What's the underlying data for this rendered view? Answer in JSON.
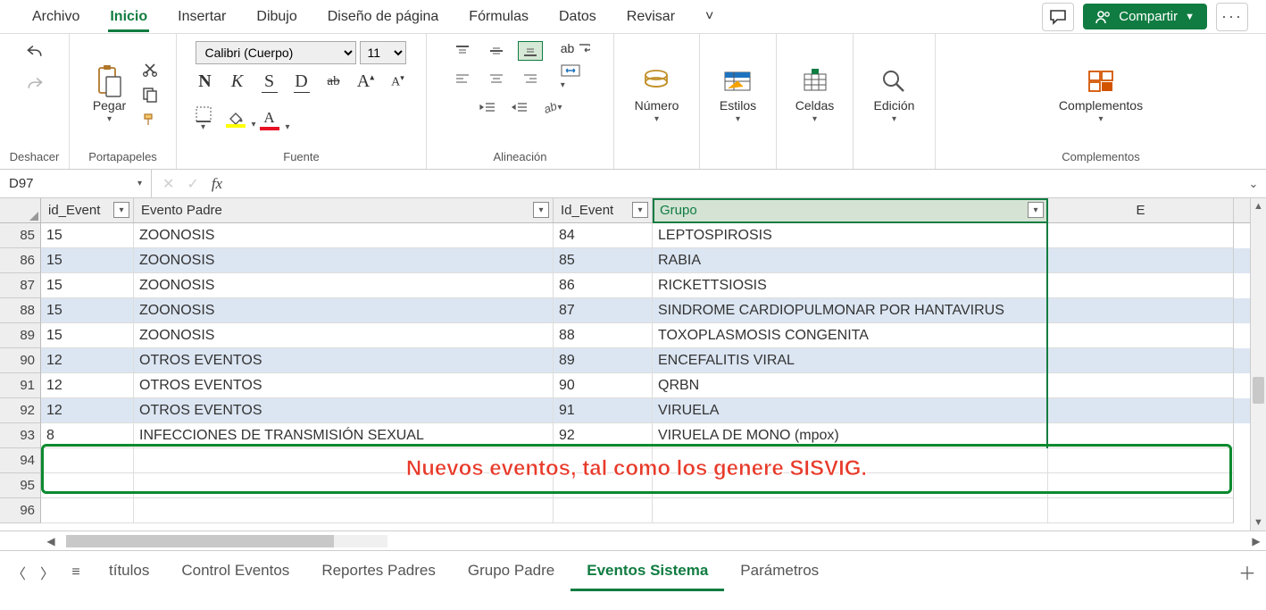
{
  "tabs": {
    "items": [
      "Archivo",
      "Inicio",
      "Insertar",
      "Dibujo",
      "Diseño de página",
      "Fórmulas",
      "Datos",
      "Revisar"
    ],
    "active_index": 1,
    "overflow": "˅"
  },
  "header_actions": {
    "share": "Compartir"
  },
  "ribbon": {
    "undo_label": "Deshacer",
    "clipboard": {
      "paste": "Pegar",
      "label": "Portapapeles"
    },
    "font": {
      "name": "Calibri (Cuerpo)",
      "size": "11",
      "label": "Fuente",
      "bold": "N",
      "italic": "K",
      "underline": "S",
      "double_underline": "D",
      "strike": "ab",
      "grow": "A",
      "shrink": "A"
    },
    "alignment": {
      "label": "Alineación",
      "wrap": "ab"
    },
    "number": {
      "label": "Número"
    },
    "styles": {
      "label": "Estilos"
    },
    "cells": {
      "label": "Celdas"
    },
    "editing": {
      "label": "Edición"
    },
    "addins": {
      "button": "Complementos",
      "label": "Complementos"
    }
  },
  "formula_bar": {
    "name_box": "D97",
    "cancel": "✕",
    "confirm": "✓",
    "fx": "fx",
    "value": ""
  },
  "columns": [
    {
      "key": "A",
      "label": "id_Event",
      "has_filter": true,
      "width": "c-a"
    },
    {
      "key": "B",
      "label": "Evento Padre",
      "has_filter": true,
      "width": "c-b"
    },
    {
      "key": "C",
      "label": "Id_Event",
      "has_filter": true,
      "width": "c-c"
    },
    {
      "key": "D",
      "label": "Grupo",
      "has_filter": true,
      "selected": true,
      "width": "c-d"
    },
    {
      "key": "E",
      "label": "E",
      "has_filter": false,
      "width": "c-e"
    }
  ],
  "rows": [
    {
      "n": 85,
      "alt": false,
      "a": "15",
      "b": "ZOONOSIS",
      "c": "84",
      "d": "LEPTOSPIROSIS"
    },
    {
      "n": 86,
      "alt": true,
      "a": "15",
      "b": "ZOONOSIS",
      "c": "85",
      "d": "RABIA"
    },
    {
      "n": 87,
      "alt": false,
      "a": "15",
      "b": "ZOONOSIS",
      "c": "86",
      "d": "RICKETTSIOSIS"
    },
    {
      "n": 88,
      "alt": true,
      "a": "15",
      "b": "ZOONOSIS",
      "c": "87",
      "d": "SINDROME CARDIOPULMONAR POR HANTAVIRUS"
    },
    {
      "n": 89,
      "alt": false,
      "a": "15",
      "b": "ZOONOSIS",
      "c": "88",
      "d": "TOXOPLASMOSIS CONGENITA"
    },
    {
      "n": 90,
      "alt": true,
      "a": "12",
      "b": "OTROS EVENTOS",
      "c": "89",
      "d": "ENCEFALITIS VIRAL"
    },
    {
      "n": 91,
      "alt": false,
      "a": "12",
      "b": "OTROS EVENTOS",
      "c": "90",
      "d": "QRBN"
    },
    {
      "n": 92,
      "alt": true,
      "a": "12",
      "b": "OTROS EVENTOS",
      "c": "91",
      "d": "VIRUELA"
    },
    {
      "n": 93,
      "alt": false,
      "a": "8",
      "b": "INFECCIONES DE TRANSMISIÓN SEXUAL",
      "c": "92",
      "d": "VIRUELA DE MONO (mpox)"
    },
    {
      "n": 94,
      "alt": false,
      "a": "",
      "b": "",
      "c": "",
      "d": ""
    },
    {
      "n": 95,
      "alt": false,
      "a": "",
      "b": "",
      "c": "",
      "d": ""
    },
    {
      "n": 96,
      "alt": false,
      "a": "",
      "b": "",
      "c": "",
      "d": ""
    }
  ],
  "annotation": "Nuevos eventos, tal como los genere SISVIG.",
  "sheet_tabs": {
    "items": [
      "títulos",
      "Control Eventos",
      "Reportes Padres",
      "Grupo  Padre",
      "Eventos Sistema",
      "Parámetros"
    ],
    "active_index": 4
  }
}
